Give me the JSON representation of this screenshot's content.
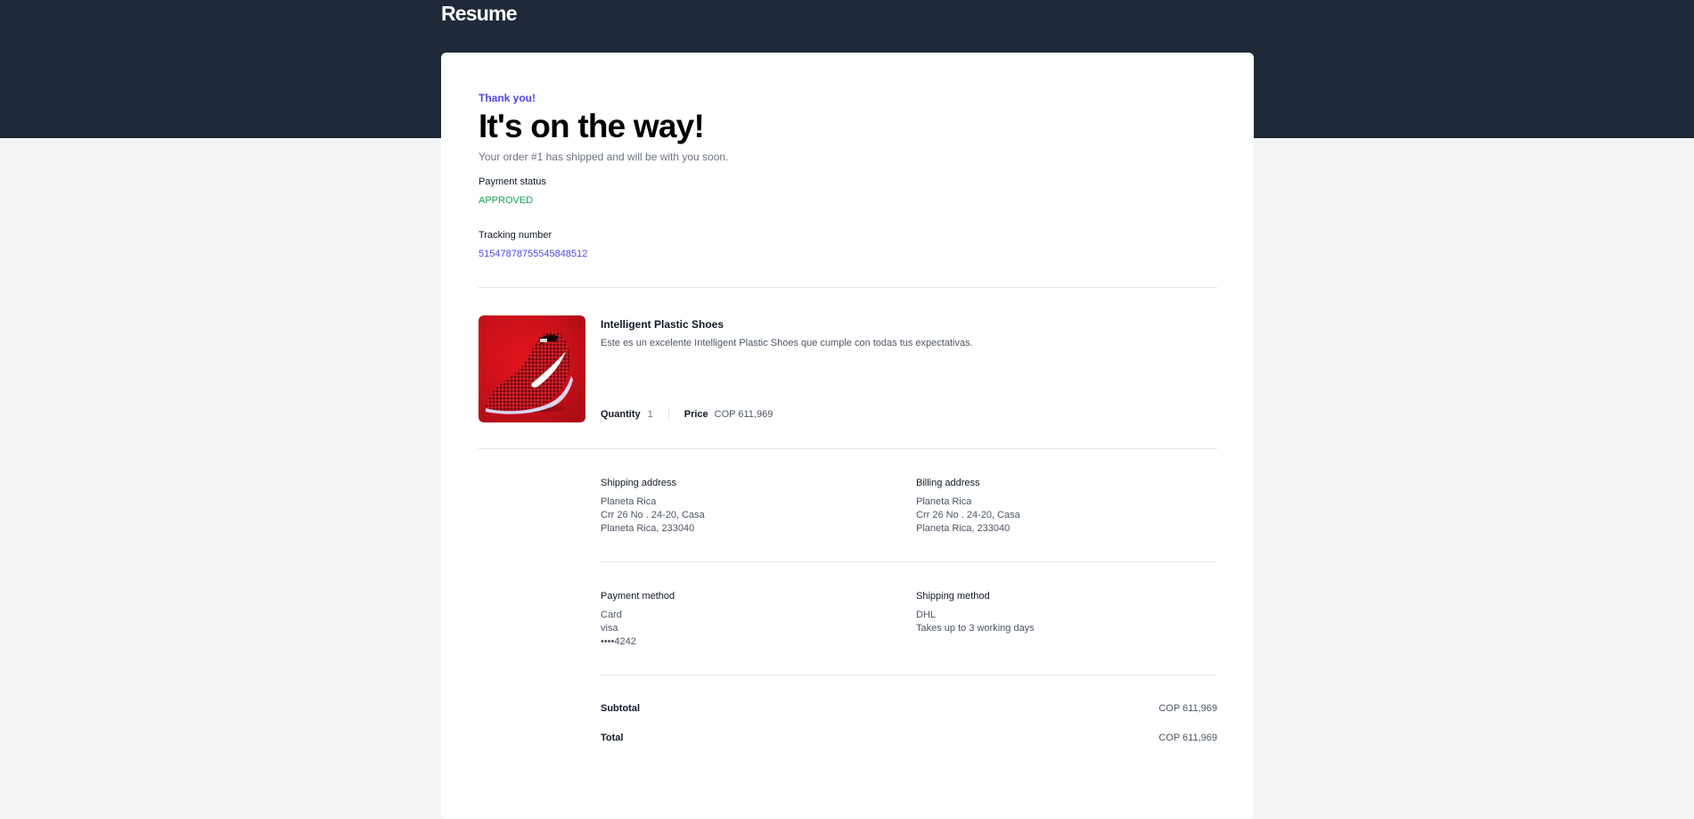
{
  "header": {
    "title": "Resume"
  },
  "order": {
    "eyebrow": "Thank you!",
    "headline": "It's on the way!",
    "message": "Your order #1 has shipped and will be with you soon.",
    "payment_status_label": "Payment status",
    "payment_status_value": "APPROVED",
    "tracking_label": "Tracking number",
    "tracking_value": "51547878755545848512"
  },
  "product": {
    "name": "Intelligent Plastic Shoes",
    "description": "Este es un excelente Intelligent Plastic Shoes que cumple con todas tus expectativas.",
    "quantity_label": "Quantity",
    "quantity_value": "1",
    "price_label": "Price",
    "price_value": "COP 611,969",
    "image_icon": "red-sneaker-image"
  },
  "shipping_address": {
    "title": "Shipping address",
    "lines": [
      "Planeta Rica",
      "Crr 26 No . 24-20, Casa",
      "Planeta Rica, 233040"
    ]
  },
  "billing_address": {
    "title": "Billing address",
    "lines": [
      "Planeta Rica",
      "Crr 26 No . 24-20, Casa",
      "Planeta Rica, 233040"
    ]
  },
  "payment_method": {
    "title": "Payment method",
    "lines": [
      "Card",
      "visa",
      "••••4242"
    ]
  },
  "shipping_method": {
    "title": "Shipping method",
    "lines": [
      "DHL",
      "Takes up to 3 working days"
    ]
  },
  "summary": {
    "subtotal_label": "Subtotal",
    "subtotal_value": "COP 611,969",
    "total_label": "Total",
    "total_value": "COP 611,969"
  },
  "colors": {
    "header_bg": "#1f2937",
    "accent": "#4f46e5",
    "success": "#16a34a",
    "page_bg": "#f3f4f6"
  }
}
